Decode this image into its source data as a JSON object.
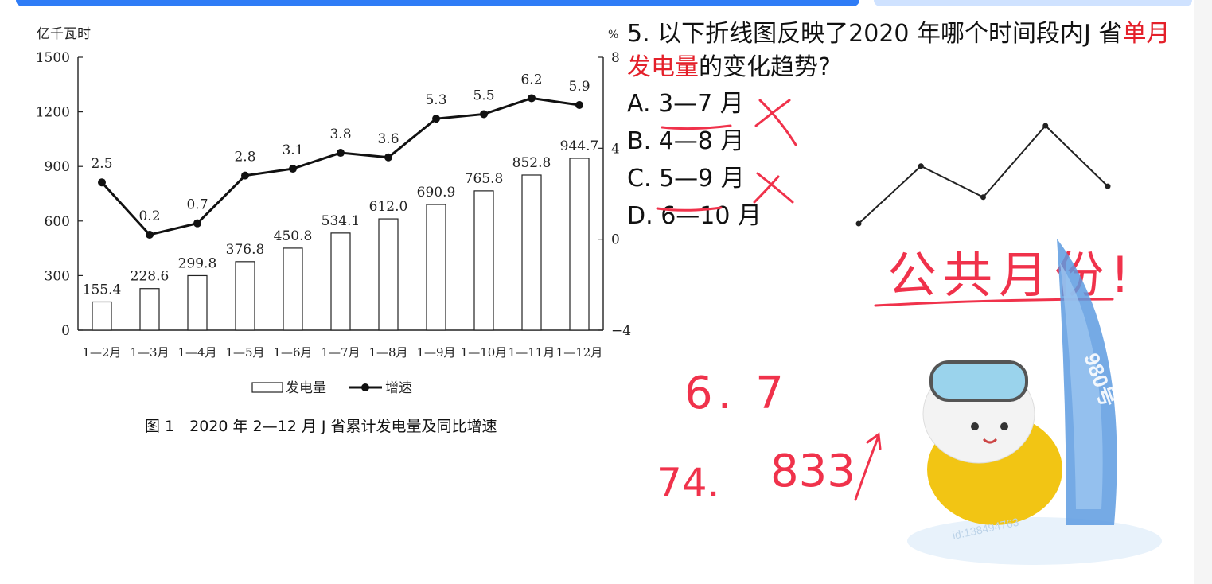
{
  "chart_data": {
    "type": "bar",
    "categories": [
      "1—2月",
      "1—3月",
      "1—4月",
      "1—5月",
      "1—6月",
      "1—7月",
      "1—8月",
      "1—9月",
      "1—10月",
      "1—11月",
      "1—12月"
    ],
    "series": [
      {
        "name": "发电量",
        "type": "bar",
        "values": [
          155.4,
          228.6,
          299.8,
          376.8,
          450.8,
          534.1,
          612.0,
          690.9,
          765.8,
          852.8,
          944.7
        ]
      },
      {
        "name": "增速",
        "type": "line",
        "values": [
          2.5,
          0.2,
          0.7,
          2.8,
          3.1,
          3.8,
          3.6,
          5.3,
          5.5,
          6.2,
          5.9
        ]
      }
    ],
    "y_left": {
      "label": "亿千瓦时",
      "ticks": [
        0,
        300,
        600,
        900,
        1200,
        1500
      ],
      "range": [
        0,
        1500
      ]
    },
    "y_right": {
      "label": "%",
      "ticks": [
        -4,
        0,
        4,
        8
      ],
      "range": [
        -4,
        8
      ]
    },
    "legend": {
      "placement": "bottom-center",
      "items": [
        "发电量",
        "增速"
      ]
    },
    "grid": false
  },
  "caption": "图 1　2020 年 2—12 月 J 省累计发电量及同比增速",
  "question": {
    "prefix": "5. 以下折线图反映了2020 年哪个时间段内J 省",
    "highlight": "单月发电量",
    "suffix": "的变化趋势?",
    "options": [
      {
        "letter": "A.",
        "text": "3—7 月"
      },
      {
        "letter": "B.",
        "text": "4—8 月"
      },
      {
        "letter": "C.",
        "text": "5—9 月"
      },
      {
        "letter": "D.",
        "text": "6—10 月"
      }
    ]
  },
  "sketch_line": [
    0.6,
    4.3,
    2.3,
    6.9,
    3.0
  ],
  "handwriting": {
    "note": "公共月份!",
    "num1": "6. 7",
    "num2": "74.",
    "num3": "833"
  },
  "mascot": {
    "badge": "980号",
    "watermark": "id:138494763"
  },
  "colors": {
    "accent_blue": "#2f7cf6",
    "ink_red": "#f0324b",
    "highlight_red": "#e4202a"
  }
}
